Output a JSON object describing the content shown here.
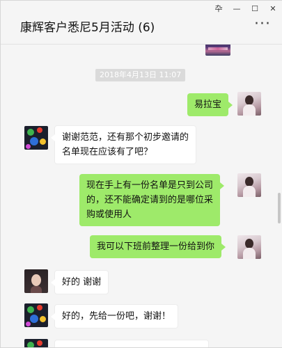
{
  "window": {
    "title": "康辉客户悉尼5月活动 (6)",
    "controls": {
      "pin": "卆",
      "minimize": "—",
      "maximize": "☐",
      "close": "✕"
    },
    "more_icon": "···"
  },
  "chat": {
    "timestamp": "2018年4月13日  11:07",
    "messages": [
      {
        "sender": "self",
        "avatar": "avatar-self",
        "lines": [
          "易拉宝"
        ]
      },
      {
        "sender": "other",
        "avatar": "avatar-art",
        "lines": [
          "谢谢范范，还有那个初步邀请的",
          "名单现在应该有了吧？"
        ]
      },
      {
        "sender": "self",
        "avatar": "avatar-self",
        "lines": [
          "现在手上有一份名单是只到公司",
          "的，还不能确定请到的是哪位采",
          "购或使用人"
        ]
      },
      {
        "sender": "self",
        "avatar": "avatar-self",
        "lines": [
          "我可以下班前整理一份给到你"
        ]
      },
      {
        "sender": "other",
        "avatar": "avatar-girl",
        "lines": [
          "好的 谢谢"
        ]
      },
      {
        "sender": "other",
        "avatar": "avatar-art",
        "lines": [
          "好的，先给一份吧，谢谢！"
        ]
      }
    ]
  }
}
